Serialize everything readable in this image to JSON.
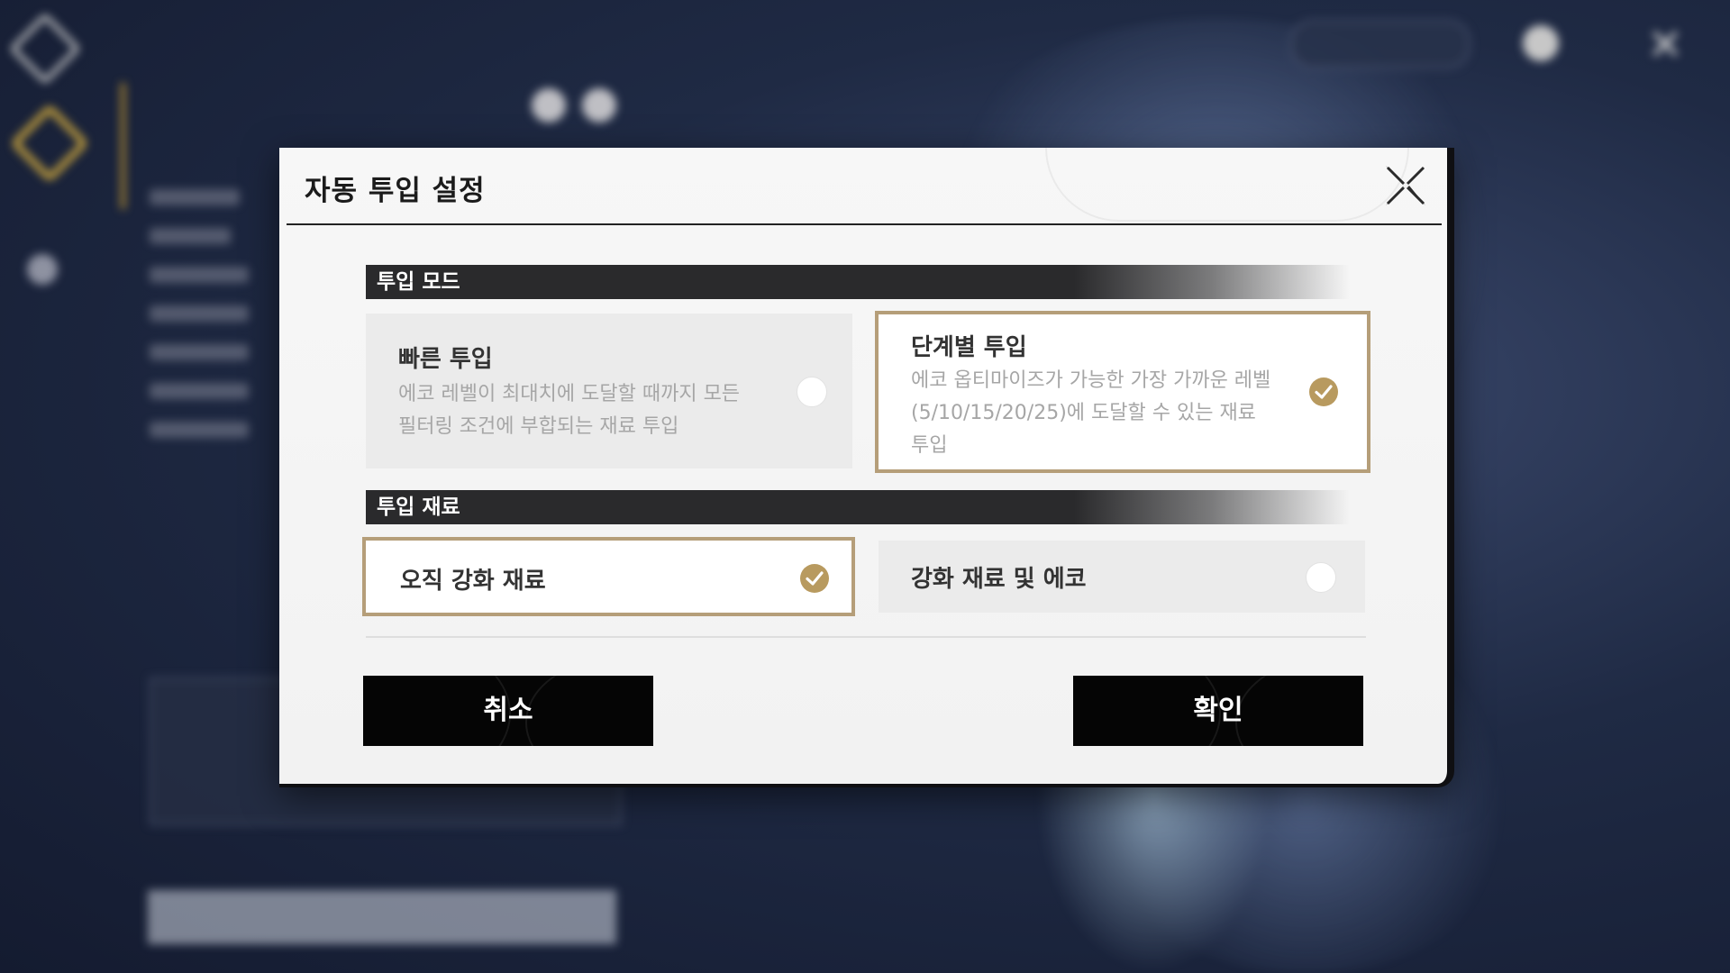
{
  "dialog": {
    "title": "자동 투입 설정",
    "mode_section": {
      "header": "투입 모드",
      "options": [
        {
          "title": "빠른 투입",
          "description_lines": [
            "에코 레벨이 최대치에 도달할 때까지 모든",
            "필터링 조건에 부합되는 재료 투입"
          ],
          "selected": false
        },
        {
          "title": "단계별 투입",
          "description_lines": [
            "에코 옵티마이즈가 가능한 가장 가까운 레벨",
            "(5/10/15/20/25)에 도달할 수 있는 재료",
            "투입"
          ],
          "selected": true
        }
      ]
    },
    "material_section": {
      "header": "투입 재료",
      "options": [
        {
          "title": "오직 강화 재료",
          "selected": true
        },
        {
          "title": "강화 재료 및 에코",
          "selected": false
        }
      ]
    },
    "buttons": {
      "cancel": "취소",
      "confirm": "확인"
    }
  },
  "colors": {
    "accent_gold": "#b89a5f",
    "selected_border": "#b59e79",
    "button_bg": "#050505",
    "section_header_bg": "#2a2a2c"
  },
  "icons": {
    "close": "close-x-icon",
    "check": "check-circle-icon"
  }
}
